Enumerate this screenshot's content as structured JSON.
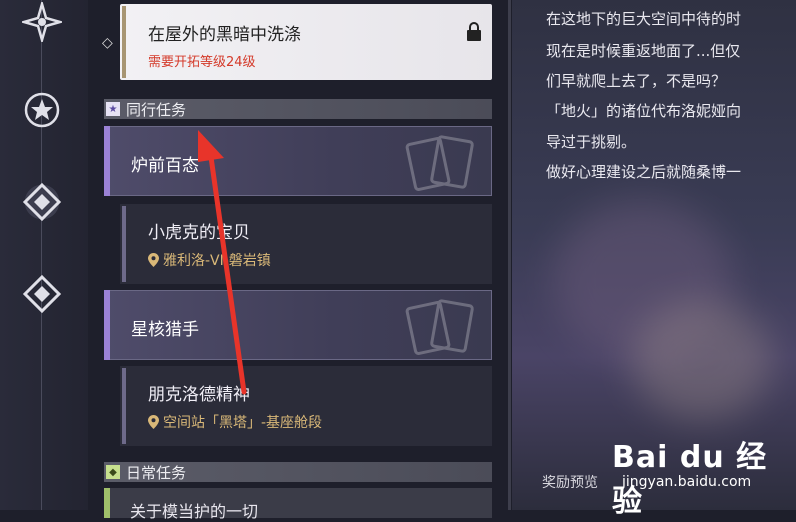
{
  "nav_rail": {
    "icons": [
      "compass-star-icon",
      "star-badge-icon",
      "diamond-quest-icon",
      "diamond-quest-icon"
    ]
  },
  "locked_mission": {
    "title": "在屋外的黑暗中洗涤",
    "requirement": "需要开拓等级24级"
  },
  "sections": {
    "companion": {
      "label": "同行任务"
    },
    "daily": {
      "label": "日常任务"
    }
  },
  "missions": {
    "group1": {
      "label": "炉前百态"
    },
    "sub1": {
      "title": "小虎克的宝贝",
      "location": "雅利洛-VI-磐岩镇"
    },
    "group2": {
      "label": "星核猎手"
    },
    "sub2": {
      "title": "朋克洛德精神",
      "location": "空间站「黑塔」-基座舱段"
    },
    "daily1": {
      "label": "关于模当护的一切"
    }
  },
  "dialog": {
    "lines": [
      "在这地下的巨大空间中待的时",
      "现在是时候重返地面了...但仅",
      "们早就爬上去了，不是吗？",
      "「地火」的诸位代布洛妮娅向",
      "导过于挑剔。",
      "做好心理建设之后就随桑博一"
    ],
    "reward_label": "奖励预览"
  },
  "watermark": {
    "brand": "Bai du 经验",
    "url": "jingyan.baidu.com"
  },
  "colors": {
    "accent_purple": "#9b82d6",
    "accent_gold": "#a79572",
    "requirement_red": "#d43a2a",
    "location_gold": "#d9b878",
    "daily_green": "#9fbf6a",
    "arrow_red": "#e8342a"
  }
}
